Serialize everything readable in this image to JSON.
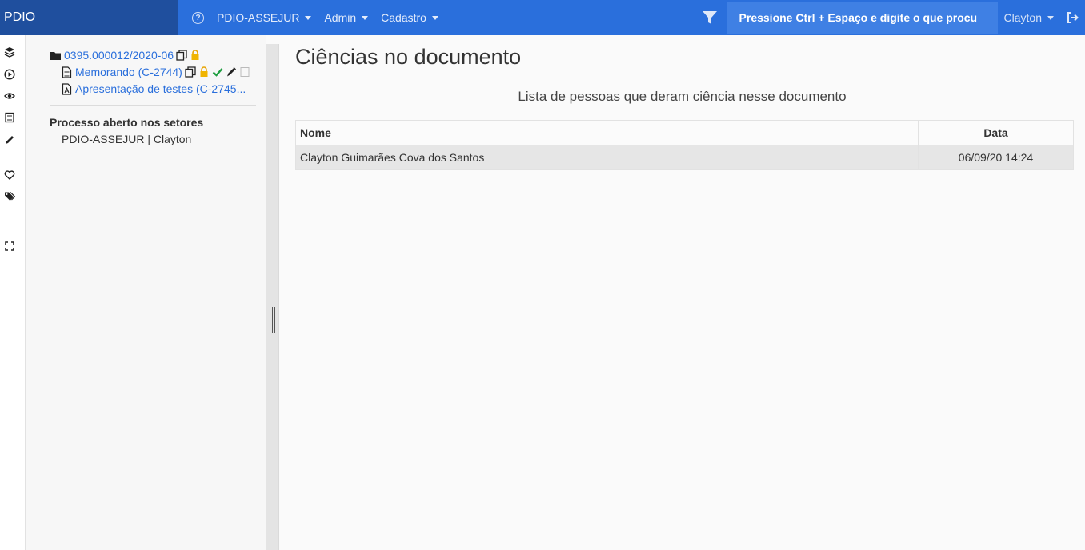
{
  "navbar": {
    "brand": "PDIO",
    "help_icon": "question-circle-icon",
    "menus": [
      {
        "label": "PDIO-ASSEJUR"
      },
      {
        "label": "Admin"
      },
      {
        "label": "Cadastro"
      }
    ],
    "filter_icon": "filter-icon",
    "search_placeholder": "Pressione Ctrl + Espaço e digite o que procu",
    "user": "Clayton",
    "logout_icon": "sign-out-icon",
    "colors": {
      "bar": "#2a6fdc",
      "brand": "#1f4f9e",
      "search": "#3f80e4"
    }
  },
  "rail": {
    "icons": [
      "layers-icon",
      "play-circle-icon",
      "eye-icon",
      "calendar-icon",
      "pen-icon",
      "heart-icon",
      "tags-icon",
      "expand-icon"
    ]
  },
  "tree": {
    "process": {
      "label": "0395.000012/2020-06",
      "icon": "folder-icon"
    },
    "documents": [
      {
        "label": "Memorando (C-2744)",
        "icon": "file-text-icon"
      },
      {
        "label": "Apresentação de testes (C-2745...",
        "icon": "file-pdf-icon"
      }
    ],
    "sectors_heading": "Processo aberto nos setores",
    "sector": "PDIO-ASSEJUR | Clayton"
  },
  "main": {
    "title": "Ciências no documento",
    "subtitle": "Lista de pessoas que deram ciência nesse documento",
    "table": {
      "headers": {
        "nome": "Nome",
        "data": "Data"
      },
      "rows": [
        {
          "nome": "Clayton Guimarães Cova dos Santos",
          "data": "06/09/20 14:24"
        }
      ]
    }
  }
}
